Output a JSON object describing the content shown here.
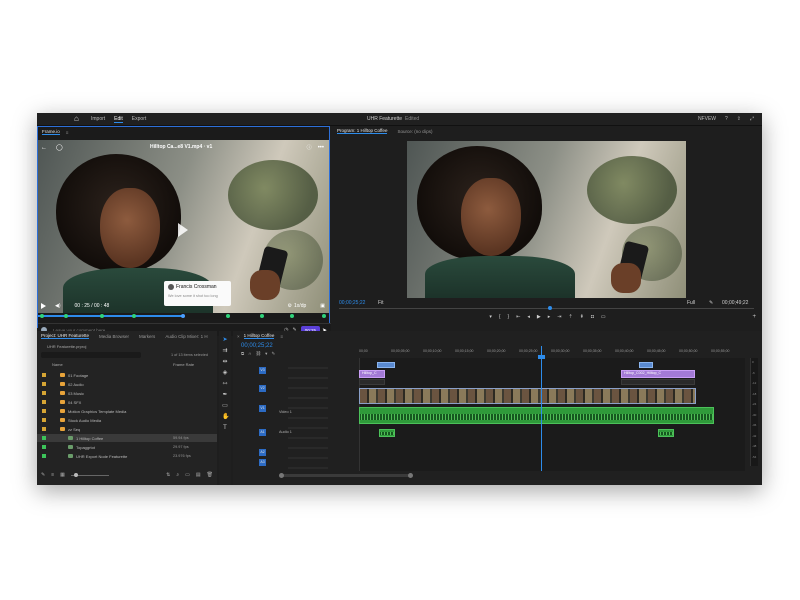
{
  "topbar": {
    "tabs": [
      "Import",
      "Edit",
      "Export"
    ],
    "active_tab": "Edit",
    "project_name": "UHR Featurette",
    "project_status": "Edited",
    "right_label": "NFVEW"
  },
  "frameio": {
    "tab_label": "Frame.io",
    "file_name": "Hilltop Ca...e8 V1.mp4 · v1",
    "popup_name": "Francis Crossman",
    "popup_message": "We love some it shot too long",
    "timecode": "00 : 25 / 00 : 48",
    "speed": "1x/dp",
    "comment_placeholder": "Leave your comment here...",
    "comment_timecode": "00:25"
  },
  "program": {
    "tab_program": "Program: 1 Hilltop Coffee",
    "tab_source": "Source: (no clips)",
    "timecode_left": "00;00;25;22",
    "fit": "Fit",
    "full": "Full",
    "timecode_right": "00;00;49;22"
  },
  "project": {
    "tabs": [
      "Project: UHR Featurette",
      "Media Browser",
      "Markers",
      "Audio Clip Mixer: 1 H"
    ],
    "path": "UHR Featurette.prproj",
    "count": "1 of 13 items selected",
    "col_name": "Name",
    "col_rate": "Frame Rate",
    "items": [
      {
        "name": "01 Footage",
        "type": "folder",
        "rate": ""
      },
      {
        "name": "02 Audio",
        "type": "folder",
        "rate": ""
      },
      {
        "name": "03 Music",
        "type": "folder",
        "rate": ""
      },
      {
        "name": "04 SFX",
        "type": "folder",
        "rate": ""
      },
      {
        "name": "Motion Graphics Template Media",
        "type": "folder",
        "rate": ""
      },
      {
        "name": "Stock Audio Media",
        "type": "folder",
        "rate": ""
      },
      {
        "name": "zz Seq",
        "type": "folder",
        "rate": ""
      },
      {
        "name": "1 Hilltop Coffee",
        "type": "seq",
        "rate": "59.94 fps"
      },
      {
        "name": "Topaggrtot",
        "type": "seq",
        "rate": "29.97 fps"
      },
      {
        "name": "UHR Export Node Featurette",
        "type": "seq",
        "rate": "23.976 fps"
      }
    ]
  },
  "timeline": {
    "tab_label": "1 Hilltop Coffee",
    "timecode": "00;00;25;22",
    "ruler": [
      "00;00",
      "00;00;05;00",
      "00;00;10;00",
      "00;00;15;00",
      "00;00;20;00",
      "00;00;25;00",
      "00;00;30;00",
      "00;00;35;00",
      "00;00;40;00",
      "00;00;45;00",
      "00;00;50;00",
      "00;00;55;00"
    ],
    "tracks": {
      "v3": "V3",
      "v2": "V2",
      "v1": "V1",
      "a1": "A1",
      "a2": "A2",
      "a3": "A3",
      "video_label": "Video 1",
      "audio_label": "Audio 1"
    },
    "clips": {
      "v2_left": "Hilltop_C",
      "v2_right": "Hilltop_C002_Hilltop_C"
    },
    "meter_labels": [
      "0",
      "-6",
      "-12",
      "-18",
      "-24",
      "-30",
      "-36",
      "-42",
      "-48",
      "-54"
    ]
  },
  "colors": {
    "accent": "#2d8ceb",
    "clip_video": "#a37ad6",
    "clip_audio": "#2f9a3a",
    "folder": "#e8a33a",
    "frameio": "#5a3fd8"
  }
}
